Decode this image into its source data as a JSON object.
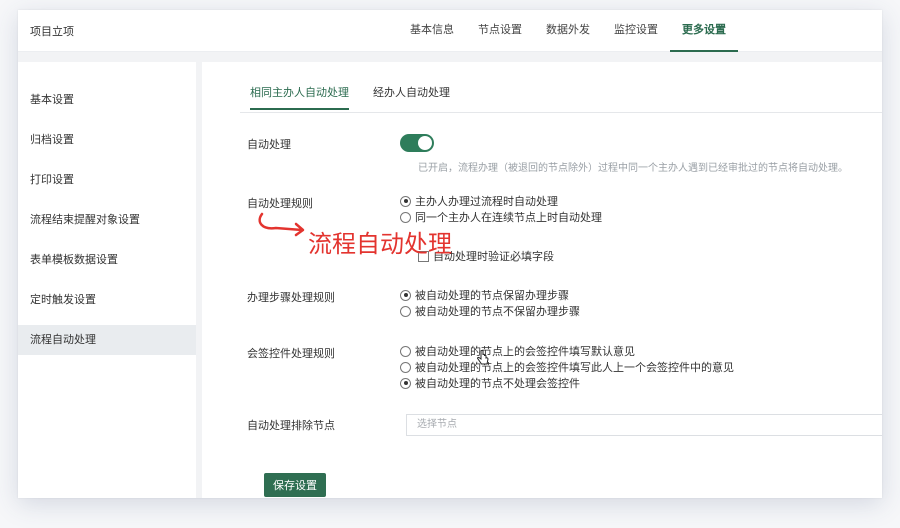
{
  "header": {
    "app_title": "项目立项",
    "nav": [
      {
        "label": "基本信息",
        "active": false
      },
      {
        "label": "节点设置",
        "active": false
      },
      {
        "label": "数据外发",
        "active": false
      },
      {
        "label": "监控设置",
        "active": false
      },
      {
        "label": "更多设置",
        "active": true
      }
    ]
  },
  "sidebar": {
    "items": [
      {
        "label": "基本设置"
      },
      {
        "label": "归档设置"
      },
      {
        "label": "打印设置"
      },
      {
        "label": "流程结束提醒对象设置"
      },
      {
        "label": "表单模板数据设置"
      },
      {
        "label": "定时触发设置"
      },
      {
        "label": "流程自动处理",
        "active": true
      }
    ]
  },
  "content": {
    "tabs": [
      {
        "label": "相同主办人自动处理",
        "active": true
      },
      {
        "label": "经办人自动处理",
        "active": false
      }
    ],
    "auto_process": {
      "label": "自动处理",
      "enabled": true,
      "hint": "已开启，流程办理（被退回的节点除外）过程中同一个主办人遇到已经审批过的节点将自动处理。"
    },
    "rule": {
      "label": "自动处理规则",
      "options": [
        {
          "label": "主办人办理过流程时自动处理",
          "checked": true
        },
        {
          "label": "同一个主办人在连续节点上时自动处理",
          "checked": false
        }
      ],
      "checkbox_label": "自动处理时验证必填字段",
      "checkbox_checked": false
    },
    "steps": {
      "label": "办理步骤处理规则",
      "options": [
        {
          "label": "被自动处理的节点保留办理步骤",
          "checked": true
        },
        {
          "label": "被自动处理的节点不保留办理步骤",
          "checked": false
        }
      ]
    },
    "sign": {
      "label": "会签控件处理规则",
      "options": [
        {
          "label": "被自动处理的节点上的会签控件填写默认意见",
          "checked": false
        },
        {
          "label": "被自动处理的节点上的会签控件填写此人上一个会签控件中的意见",
          "checked": false
        },
        {
          "label": "被自动处理的节点不处理会签控件",
          "checked": true
        }
      ]
    },
    "exclude": {
      "label": "自动处理排除节点",
      "placeholder": "选择节点"
    },
    "save_label": "保存设置"
  },
  "annotation": {
    "text": "流程自动处理",
    "color": "#e3342f"
  },
  "colors": {
    "accent": "#2b6b4f",
    "toggle_on": "#2e7d5b",
    "button": "#2f6e52"
  }
}
